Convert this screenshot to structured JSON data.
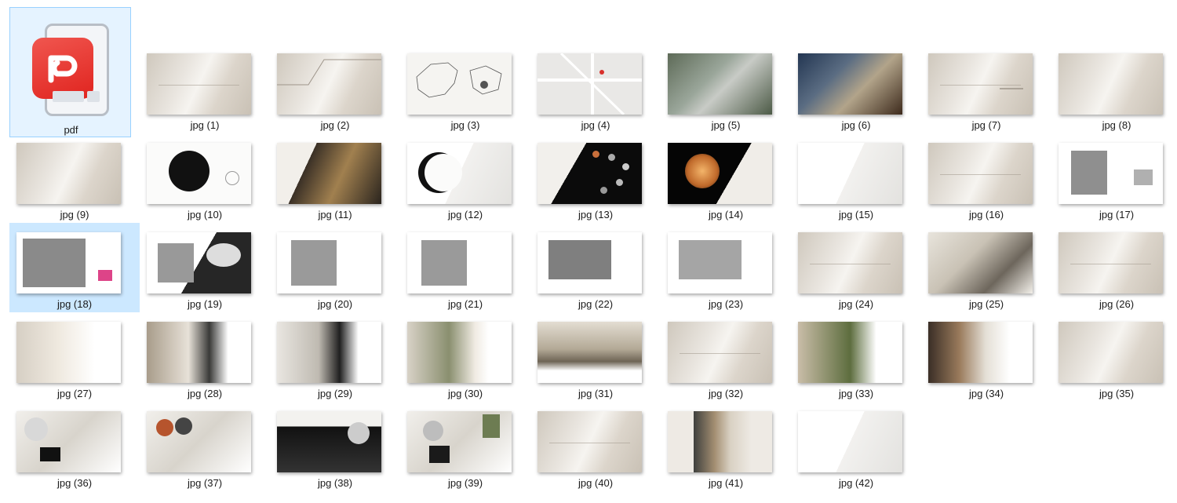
{
  "pdf_file": {
    "label": "pdf",
    "icon": "wps-pdf-icon"
  },
  "files": [
    {
      "label": "jpg (1)"
    },
    {
      "label": "jpg (2)"
    },
    {
      "label": "jpg (3)"
    },
    {
      "label": "jpg (4)"
    },
    {
      "label": "jpg (5)"
    },
    {
      "label": "jpg (6)"
    },
    {
      "label": "jpg (7)"
    },
    {
      "label": "jpg (8)"
    },
    {
      "label": "jpg (9)"
    },
    {
      "label": "jpg (10)"
    },
    {
      "label": "jpg (11)"
    },
    {
      "label": "jpg (12)"
    },
    {
      "label": "jpg (13)"
    },
    {
      "label": "jpg (14)"
    },
    {
      "label": "jpg (15)"
    },
    {
      "label": "jpg (16)"
    },
    {
      "label": "jpg (17)"
    },
    {
      "label": "jpg (18)"
    },
    {
      "label": "jpg (19)"
    },
    {
      "label": "jpg (20)"
    },
    {
      "label": "jpg (21)"
    },
    {
      "label": "jpg (22)"
    },
    {
      "label": "jpg (23)"
    },
    {
      "label": "jpg (24)"
    },
    {
      "label": "jpg (25)"
    },
    {
      "label": "jpg (26)"
    },
    {
      "label": "jpg (27)"
    },
    {
      "label": "jpg (28)"
    },
    {
      "label": "jpg (29)"
    },
    {
      "label": "jpg (30)"
    },
    {
      "label": "jpg (31)"
    },
    {
      "label": "jpg (32)"
    },
    {
      "label": "jpg (33)"
    },
    {
      "label": "jpg (34)"
    },
    {
      "label": "jpg (35)"
    },
    {
      "label": "jpg (36)"
    },
    {
      "label": "jpg (37)"
    },
    {
      "label": "jpg (38)"
    },
    {
      "label": "jpg (39)"
    },
    {
      "label": "jpg (40)"
    },
    {
      "label": "jpg (41)"
    },
    {
      "label": "jpg (42)"
    }
  ],
  "selected_file": "jpg (18)",
  "colors": {
    "selection": "#cce8ff",
    "pdf_red": "#e8312b"
  }
}
